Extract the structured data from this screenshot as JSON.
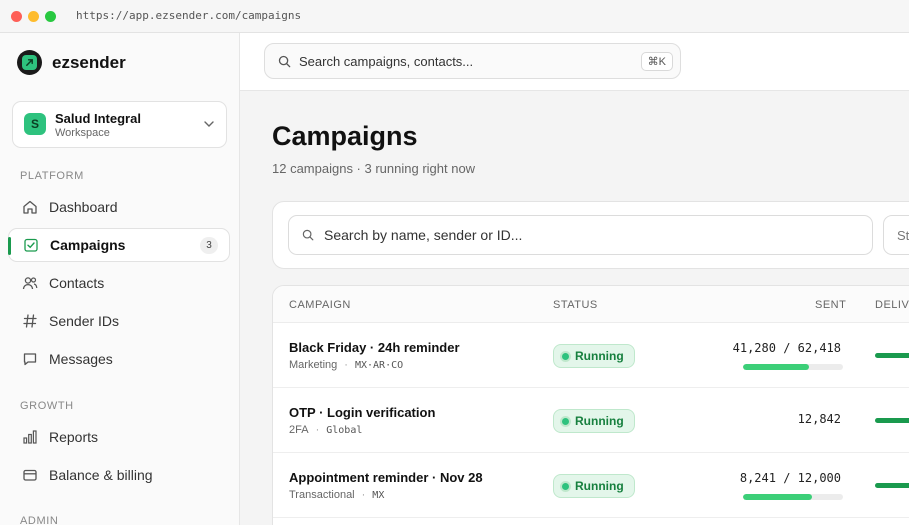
{
  "browser": {
    "url": "https://app.ezsender.com/campaigns"
  },
  "brand": {
    "name": "ezsender"
  },
  "workspace": {
    "initial": "S",
    "name": "Salud Integral",
    "label": "Workspace"
  },
  "sidebar": {
    "sections": [
      {
        "label": "PLATFORM"
      },
      {
        "label": "GROWTH"
      },
      {
        "label": "ADMIN"
      }
    ],
    "items": [
      {
        "label": "Dashboard",
        "icon": "home-icon"
      },
      {
        "label": "Campaigns",
        "icon": "campaign-icon",
        "badge": "3",
        "active": true
      },
      {
        "label": "Contacts",
        "icon": "contacts-icon"
      },
      {
        "label": "Sender IDs",
        "icon": "hash-icon"
      },
      {
        "label": "Messages",
        "icon": "message-icon"
      },
      {
        "label": "Reports",
        "icon": "reports-icon"
      },
      {
        "label": "Balance & billing",
        "icon": "billing-icon"
      }
    ]
  },
  "topbar": {
    "search_placeholder": "Search campaigns, contacts...",
    "shortcut": "⌘K"
  },
  "page": {
    "title": "Campaigns",
    "subtitle": "12 campaigns · 3 running right now"
  },
  "filters": {
    "search_placeholder": "Search by name, sender or ID...",
    "status_label": "Sta"
  },
  "table": {
    "headers": {
      "campaign": "CAMPAIGN",
      "status": "STATUS",
      "sent": "SENT",
      "delivered": "DELIVE"
    },
    "rows": [
      {
        "name": "Black Friday · 24h reminder",
        "type": "Marketing",
        "region": "MX·AR·CO",
        "status": "Running",
        "sent": "41,280 / 62,418",
        "progress": 0.66
      },
      {
        "name": "OTP · Login verification",
        "type": "2FA",
        "region": "Global",
        "status": "Running",
        "sent": "12,842",
        "progress": null
      },
      {
        "name": "Appointment reminder · Nov 28",
        "type": "Transactional",
        "region": "MX",
        "status": "Running",
        "sent": "8,241 / 12,000",
        "progress": 0.69
      }
    ]
  },
  "colors": {
    "accent": "#2ec27e",
    "accent_dark": "#1a9a4e",
    "running_bg": "#e3f6ea"
  }
}
